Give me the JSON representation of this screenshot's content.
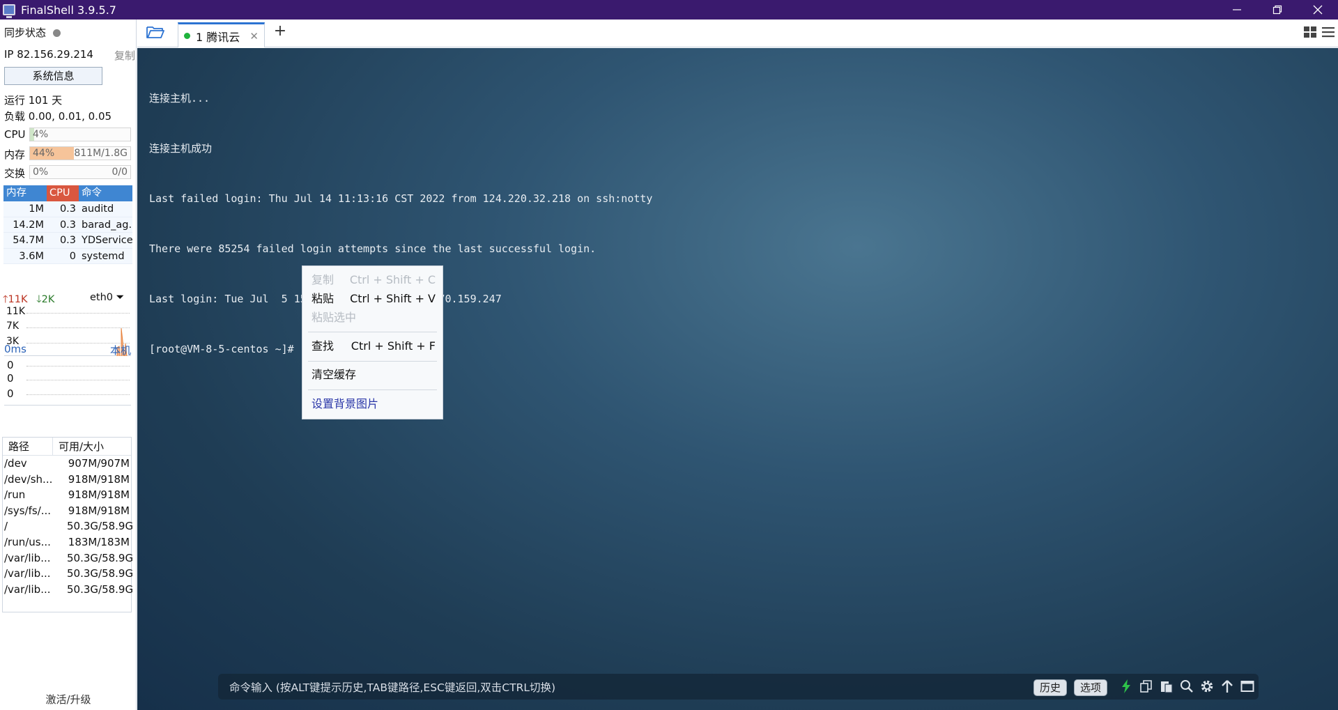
{
  "window": {
    "title": "FinalShell 3.9.5.7"
  },
  "sidebar": {
    "sync_label": "同步状态",
    "ip_label": "IP 82.156.29.214",
    "copy_label": "复制",
    "sysinfo_button": "系统信息",
    "uptime": "运行 101 天",
    "load": "负载 0.00, 0.01, 0.05",
    "cpu": {
      "label": "CPU",
      "value": "4%",
      "percent": 4
    },
    "mem": {
      "label": "内存",
      "value": "44%",
      "detail": "811M/1.8G",
      "percent": 44
    },
    "swap": {
      "label": "交换",
      "value": "0%",
      "detail": "0/0",
      "percent": 0
    },
    "process_table": {
      "headers": [
        "内存",
        "CPU",
        "命令"
      ],
      "rows": [
        [
          "1M",
          "0.3",
          "auditd"
        ],
        [
          "14.2M",
          "0.3",
          "barad_ag.."
        ],
        [
          "54.7M",
          "0.3",
          "YDService"
        ],
        [
          "3.6M",
          "0",
          "systemd"
        ]
      ]
    },
    "network": {
      "up": "11K",
      "down": "2K",
      "interface": "eth0",
      "scale": [
        "11K",
        "7K",
        "3K"
      ]
    },
    "latency": {
      "ms": "0ms",
      "host": "本机",
      "values": [
        "0",
        "0",
        "0"
      ]
    },
    "disk_table": {
      "headers": [
        "路径",
        "可用/大小"
      ],
      "rows": [
        [
          "/dev",
          "907M/907M"
        ],
        [
          "/dev/sh...",
          "918M/918M"
        ],
        [
          "/run",
          "918M/918M"
        ],
        [
          "/sys/fs/...",
          "918M/918M"
        ],
        [
          "/",
          "50.3G/58.9G"
        ],
        [
          "/run/us...",
          "183M/183M"
        ],
        [
          "/var/lib...",
          "50.3G/58.9G"
        ],
        [
          "/var/lib...",
          "50.3G/58.9G"
        ],
        [
          "/var/lib...",
          "50.3G/58.9G"
        ]
      ]
    },
    "activate": "激活/升级"
  },
  "tabs": [
    {
      "label": "1 腾讯云",
      "active": true,
      "connected": true
    }
  ],
  "terminal": {
    "lines": [
      "连接主机...",
      "连接主机成功",
      "Last failed login: Thu Jul 14 11:13:16 CST 2022 from 124.220.32.218 on ssh:notty",
      "There were 85254 failed login attempts since the last successful login.",
      "Last login: Tue Jul  5 15:09:41 2022 from 223.70.159.247",
      "[root@VM-8-5-centos ~]#"
    ]
  },
  "context_menu": {
    "copy": {
      "label": "复制",
      "shortcut": "Ctrl + Shift + C",
      "enabled": false
    },
    "paste": {
      "label": "粘贴",
      "shortcut": "Ctrl + Shift + V",
      "enabled": true
    },
    "paste_selection": {
      "label": "粘贴选中",
      "enabled": false
    },
    "find": {
      "label": "查找",
      "shortcut": "Ctrl + Shift + F",
      "enabled": true
    },
    "clear_cache": {
      "label": "清空缓存"
    },
    "set_background": {
      "label": "设置背景图片"
    }
  },
  "command_bar": {
    "placeholder": "命令输入 (按ALT键提示历史,TAB键路径,ESC键返回,双击CTRL切换)",
    "history_button": "历史",
    "options_button": "选项"
  },
  "colors": {
    "titlebar": "#3a1a6e",
    "cpu_header": "#d9573f",
    "mem_header": "#3f86d2",
    "mem_fill": "#f6c49a",
    "accent_link": "#2a36a8",
    "connected": "#1fb33d"
  }
}
